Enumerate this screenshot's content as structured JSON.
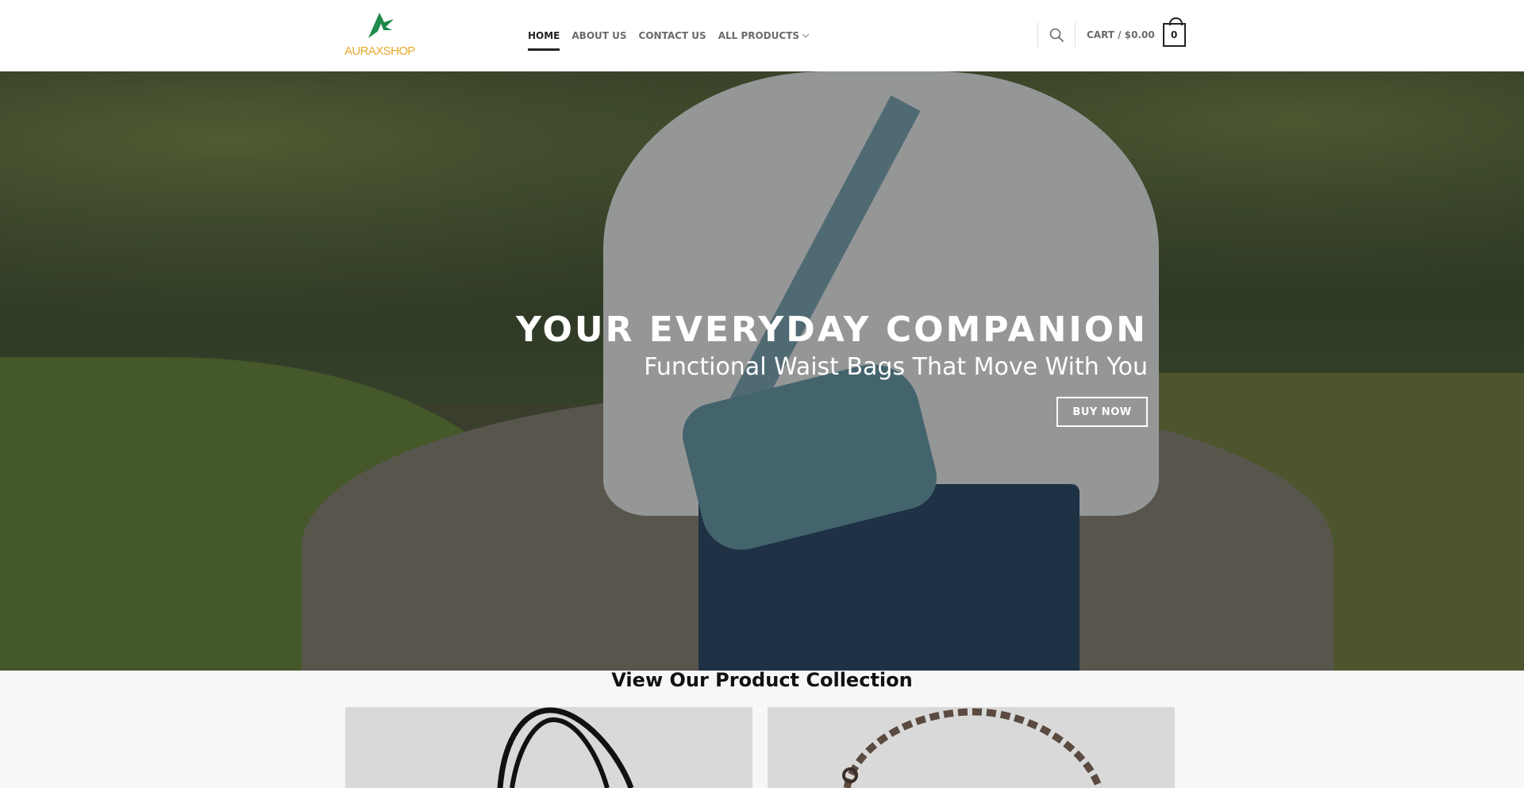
{
  "header": {
    "logo_text": "AURAXSHOP",
    "logo_colors": {
      "mark": "#1f8a4c",
      "text": "#e6a92b"
    },
    "nav": [
      {
        "label": "HOME",
        "active": true
      },
      {
        "label": "ABOUT US",
        "active": false
      },
      {
        "label": "CONTACT US",
        "active": false
      },
      {
        "label": "ALL PRODUCTS",
        "active": false,
        "has_dropdown": true
      }
    ],
    "search_icon": "search-icon",
    "cart": {
      "label": "CART / $0.00",
      "count": "0"
    }
  },
  "hero": {
    "title": "YOUR EVERYDAY COMPANION",
    "subtitle": "Functional Waist Bags That Move With You",
    "button_label": "BUY NOW"
  },
  "collection": {
    "title": "View Our Product Collection",
    "cards": [
      {
        "name": "product-card-1",
        "image": "black handbag"
      },
      {
        "name": "product-card-2",
        "image": "tortoise chain bag"
      }
    ]
  }
}
